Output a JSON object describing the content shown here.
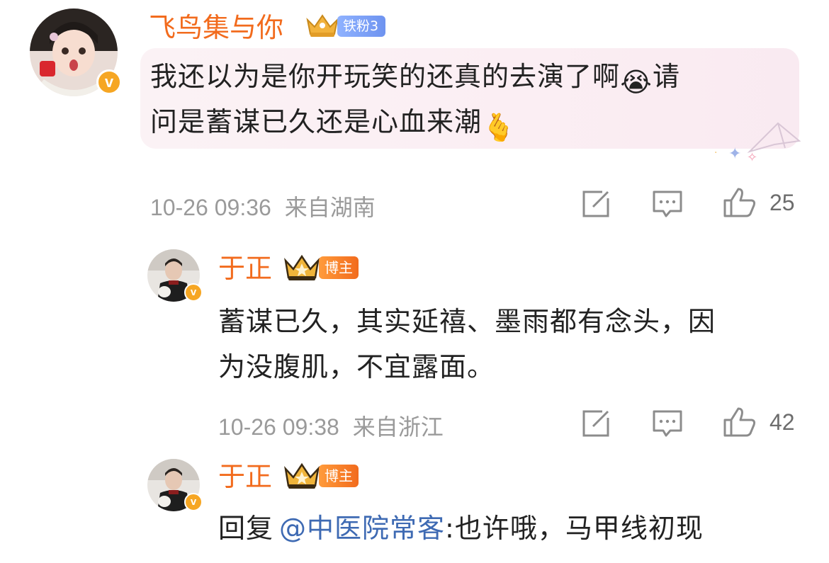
{
  "comment": {
    "user": {
      "name": "飞鸟集与你",
      "fan_badge": "铁粉3"
    },
    "text_line1": "我还以为是你开玩笑的还真的去演了啊",
    "emoji1": "😭",
    "text_line1_end": "请",
    "text_line2": "问是蓄谋已久还是心血来潮",
    "emoji2": "🫰",
    "timestamp": "10-26 09:36",
    "location": "来自湖南",
    "likes": "25"
  },
  "replies": [
    {
      "user": {
        "name": "于正",
        "badge": "博主"
      },
      "text_line1": "蓄谋已久，其实延禧、墨雨都有念头，因",
      "text_line2": "为没腹肌，不宜露面。",
      "timestamp": "10-26 09:38",
      "location": "来自浙江",
      "likes": "42"
    },
    {
      "user": {
        "name": "于正",
        "badge": "博主"
      },
      "reply_prefix": "回复",
      "mention": "@中医院常客",
      "text": ":也许哦，马甲线初现"
    }
  ],
  "icons": {
    "edit": "edit-icon",
    "comment": "comment-icon",
    "like": "thumbs-up-icon",
    "verified": "verified-badge-icon",
    "crown": "crown-icon"
  },
  "colors": {
    "name_orange": "#f26b1d",
    "mention_blue": "#3e6ab3",
    "meta_gray": "#9a9a9a",
    "verified_gold": "#f6a623"
  }
}
